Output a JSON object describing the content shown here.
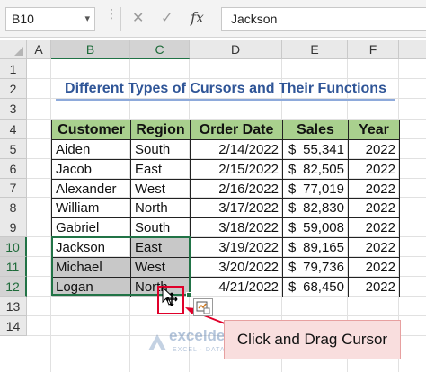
{
  "formula_bar": {
    "name_box": "B10",
    "cancel_symbol": "✕",
    "enter_symbol": "✓",
    "fx_label": "fx",
    "value": "Jackson"
  },
  "columns": [
    "A",
    "B",
    "C",
    "D",
    "E",
    "F"
  ],
  "rows": [
    "1",
    "2",
    "3",
    "4",
    "5",
    "6",
    "7",
    "8",
    "9",
    "10",
    "11",
    "12",
    "13",
    "14"
  ],
  "title": "Different Types of Cursors and Their Functions",
  "table": {
    "headers": [
      "Customer",
      "Region",
      "Order Date",
      "Sales",
      "Year"
    ],
    "rows": [
      {
        "customer": "Aiden",
        "region": "South",
        "date": "2/14/2022",
        "currency": "$",
        "sales": "55,341",
        "year": "2022"
      },
      {
        "customer": "Jacob",
        "region": "East",
        "date": "2/15/2022",
        "currency": "$",
        "sales": "82,505",
        "year": "2022"
      },
      {
        "customer": "Alexander",
        "region": "West",
        "date": "2/16/2022",
        "currency": "$",
        "sales": "77,019",
        "year": "2022"
      },
      {
        "customer": "William",
        "region": "North",
        "date": "3/17/2022",
        "currency": "$",
        "sales": "82,830",
        "year": "2022"
      },
      {
        "customer": "Gabriel",
        "region": "South",
        "date": "3/18/2022",
        "currency": "$",
        "sales": "59,008",
        "year": "2022"
      },
      {
        "customer": "Jackson",
        "region": "East",
        "date": "3/19/2022",
        "currency": "$",
        "sales": "89,165",
        "year": "2022"
      },
      {
        "customer": "Michael",
        "region": "West",
        "date": "3/20/2022",
        "currency": "$",
        "sales": "79,736",
        "year": "2022"
      },
      {
        "customer": "Logan",
        "region": "North",
        "date": "4/21/2022",
        "currency": "$",
        "sales": "68,450",
        "year": "2022"
      }
    ]
  },
  "callout": "Click and Drag Cursor",
  "watermark": {
    "name": "exceldemy",
    "tagline": "EXCEL · DATA · BI"
  },
  "colors": {
    "header_fill": "#a9d08e",
    "title_color": "#2f5597",
    "selection_border": "#217346",
    "highlight_rect": "#e0002a",
    "callout_fill": "#f9dede"
  }
}
